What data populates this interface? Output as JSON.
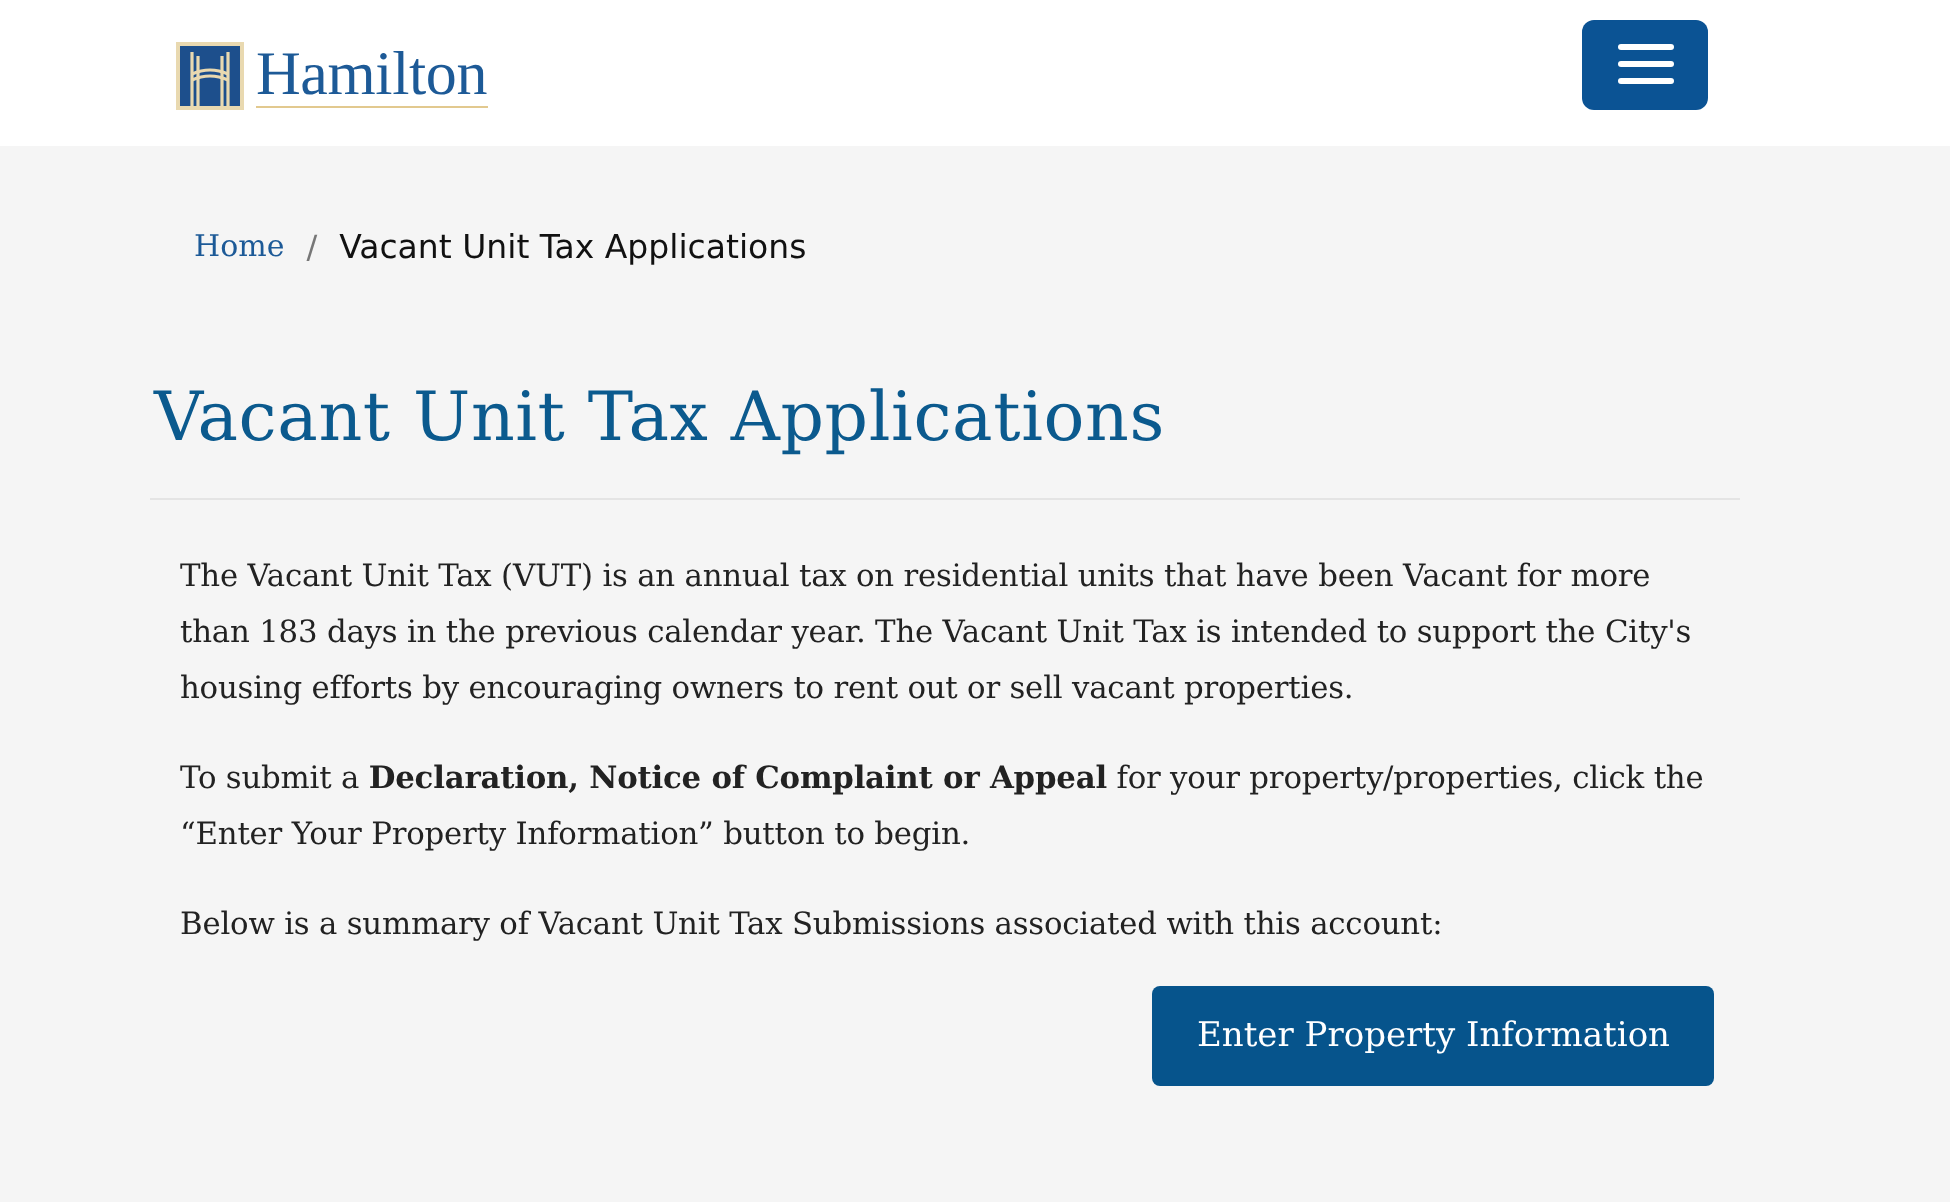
{
  "header": {
    "logo_text": "Hamilton"
  },
  "breadcrumb": {
    "separator": "/",
    "items": [
      {
        "label": "Home",
        "kind": "link"
      },
      {
        "label": "Vacant Unit Tax Applications",
        "kind": "current"
      }
    ]
  },
  "page_title": "Vacant Unit Tax Applications",
  "paragraphs": [
    "The Vacant Unit Tax (VUT) is an annual tax on residential units that have been Vacant for more than 183 days in the previous calendar year. The Vacant Unit Tax is intended to support the City's housing efforts by encouraging owners to rent out or sell vacant properties.",
    "To submit a **Declaration, Notice of Complaint or Appeal** for your property/properties, click the “Enter Your Property Information” button to begin.",
    "Below is a summary of Vacant Unit Tax Submissions associated with this account:"
  ],
  "button": {
    "label": "Enter Property Information"
  }
}
